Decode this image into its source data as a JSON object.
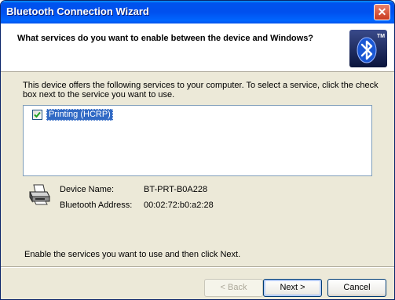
{
  "window": {
    "title": "Bluetooth Connection Wizard",
    "close_glyph": "✕"
  },
  "header": {
    "question": "What services do you want to enable between the device and Windows?",
    "logo_mark": "TM"
  },
  "intro": "This device offers the following services to your computer. To select a service, click the check box next to the service you want to use.",
  "services": [
    {
      "label": "Printing (HCRP)",
      "checked": true
    }
  ],
  "device": {
    "name_label": "Device Name:",
    "name_value": "BT-PRT-B0A228",
    "address_label": "Bluetooth Address:",
    "address_value": "00:02:72:b0:a2:28"
  },
  "footer_text": "Enable the services you want to use and then click Next.",
  "buttons": {
    "back": "< Back",
    "next": "Next >",
    "cancel": "Cancel"
  },
  "colors": {
    "title_bar": "#0058ee",
    "face": "#ece9d8",
    "selection": "#316ac5",
    "close": "#c93a1e"
  },
  "icons": [
    "close-icon",
    "bluetooth-logo-icon",
    "checkmark-icon",
    "printer-icon"
  ]
}
